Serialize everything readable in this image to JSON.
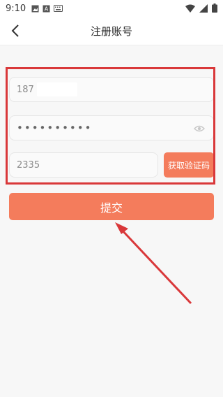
{
  "status": {
    "time": "9:10"
  },
  "header": {
    "title": "注册账号"
  },
  "form": {
    "phone_value": "187",
    "password_value": "••••••••••",
    "code_value": "2335",
    "get_code_label": "获取验证码",
    "submit_label": "提交"
  },
  "colors": {
    "accent": "#f47c5c",
    "highlight_box": "#d9383a"
  }
}
